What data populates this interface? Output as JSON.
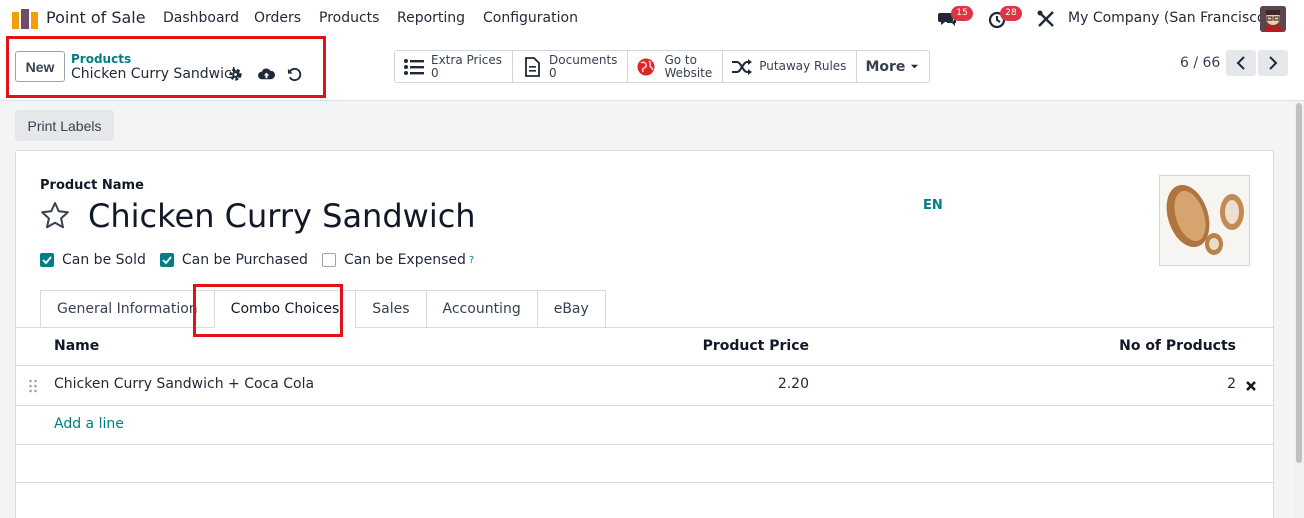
{
  "navbar": {
    "app_name": "Point of Sale",
    "menu": [
      "Dashboard",
      "Orders",
      "Products",
      "Reporting",
      "Configuration"
    ],
    "messages_count": "15",
    "activities_count": "28",
    "company": "My Company (San Francisco)"
  },
  "control": {
    "new_label": "New",
    "breadcrumb": "Products",
    "record_name": "Chicken Curry Sandwich",
    "smart_buttons": [
      {
        "label": "Extra Prices",
        "value": "0",
        "icon": "list-icon"
      },
      {
        "label": "Documents",
        "value": "0",
        "icon": "document-icon"
      },
      {
        "label": "Go to",
        "value": "Website",
        "icon": "globe-icon"
      },
      {
        "label": "Putaway Rules",
        "value": "",
        "icon": "shuffle-icon"
      }
    ],
    "more_label": "More",
    "pager": "6 / 66"
  },
  "actions": {
    "print_labels": "Print Labels"
  },
  "form": {
    "product_name_label": "Product Name",
    "product_name": "Chicken Curry Sandwich",
    "lang": "EN",
    "checkboxes": [
      {
        "label": "Can be Sold",
        "checked": true
      },
      {
        "label": "Can be Purchased",
        "checked": true
      },
      {
        "label": "Can be Expensed",
        "checked": false
      }
    ],
    "help_mark": "?"
  },
  "tabs": [
    "General Information",
    "Combo Choices",
    "Sales",
    "Accounting",
    "eBay"
  ],
  "active_tab": "Combo Choices",
  "table": {
    "columns": [
      "Name",
      "Product Price",
      "No of Products"
    ],
    "rows": [
      {
        "name": "Chicken Curry Sandwich + Coca Cola",
        "price": "2.20",
        "qty": "2"
      }
    ],
    "add_line": "Add a line"
  },
  "colors": {
    "accent": "#017e84",
    "brand": "#714b67",
    "badge": "#dc3545",
    "highlight": "#e0131a"
  }
}
